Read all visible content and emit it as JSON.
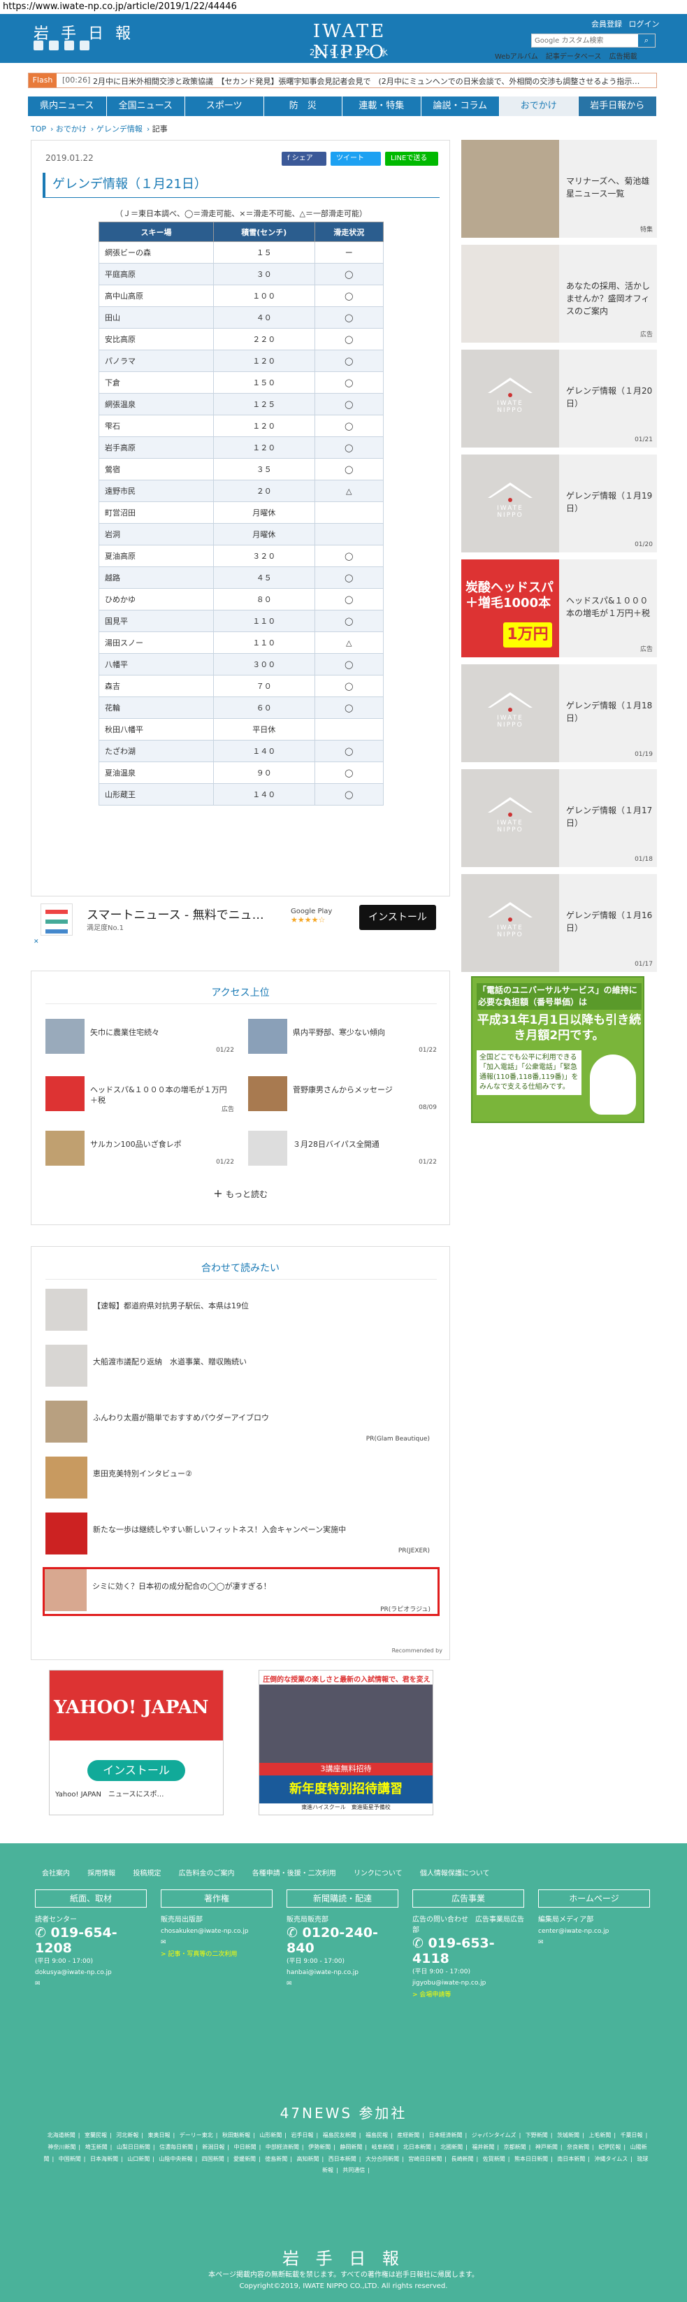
{
  "url": "https://www.iwate-np.co.jp/article/2019/1/22/44446",
  "header": {
    "logo": "岩 手 日 報",
    "brand": "IWATE NIPPO",
    "date": "2019.01.22. 水",
    "member_register": "会員登録",
    "login": "ログイン",
    "search_placeholder": "Google カスタム検索",
    "sublinks": [
      "Webアルバム",
      "記事データベース",
      "広告掲載"
    ]
  },
  "flash": {
    "tag": "Flash",
    "time": "[00:26]",
    "text": "2月中に日米外相間交渉と政策協議　【セカンド発見】張曙宇知事会見記者会見で　(2月中にミュンヘンでの日米会談で、外相間の交渉も調整させるよう指示…"
  },
  "nav": [
    "県内ニュース",
    "全国ニュース",
    "スポーツ",
    "防　災",
    "連載・特集",
    "論説・コラム",
    "おでかけ",
    "岩手日報から"
  ],
  "breadcrumb": [
    "TOP",
    "おでかけ",
    "ゲレンデ情報",
    "記事"
  ],
  "article": {
    "date": "2019.01.22",
    "share_fb": "f シェア",
    "share_tw": "ツイート",
    "share_line": "LINEで送る",
    "title": "ゲレンデ情報（１月21日）",
    "legend": "（Ｊ＝東日本調べ、◯＝滑走可能、×＝滑走不可能、△＝一部滑走可能）",
    "table_headers": [
      "スキー場",
      "積雪(センチ)",
      "滑走状況"
    ],
    "rows": [
      [
        "網張ビーの森",
        "１５",
        "ー"
      ],
      [
        "平庭高原",
        "３０",
        "◯"
      ],
      [
        "高中山高原",
        "１００",
        "◯"
      ],
      [
        "田山",
        "４０",
        "◯"
      ],
      [
        "安比高原",
        "２２０",
        "◯"
      ],
      [
        "パノラマ",
        "１２０",
        "◯"
      ],
      [
        "下倉",
        "１５０",
        "◯"
      ],
      [
        "網張温泉",
        "１２５",
        "◯"
      ],
      [
        "雫石",
        "１２０",
        "◯"
      ],
      [
        "岩手高原",
        "１２０",
        "◯"
      ],
      [
        "鶯宿",
        "３５",
        "◯"
      ],
      [
        "遠野市民",
        "２０",
        "△"
      ],
      [
        "町営沼田",
        "月曜休",
        ""
      ],
      [
        "岩洞",
        "月曜休",
        ""
      ],
      [
        "夏油高原",
        "３２０",
        "◯"
      ],
      [
        "越路",
        "４５",
        "◯"
      ],
      [
        "ひめかゆ",
        "８０",
        "◯"
      ],
      [
        "国見平",
        "１１０",
        "◯"
      ],
      [
        "湯田スノー",
        "１１０",
        "△"
      ],
      [
        "八幡平",
        "３００",
        "◯"
      ],
      [
        "森吉",
        "７０",
        "◯"
      ],
      [
        "花輪",
        "６０",
        "◯"
      ],
      [
        "秋田八幡平",
        "平日休",
        ""
      ],
      [
        "たざわ湖",
        "１４０",
        "◯"
      ],
      [
        "夏油温泉",
        "９０",
        "◯"
      ],
      [
        "山形蔵王",
        "１４０",
        "◯"
      ]
    ]
  },
  "app_ad": {
    "title": "スマートニュース - 無料でニュ…",
    "sub": "満足度No.1",
    "store": "Google Play",
    "stars": "★★★★☆",
    "install": "インストール"
  },
  "sidebar": [
    {
      "text": "マリナーズへ、菊池雄星ニュース一覧",
      "date": "特集"
    },
    {
      "text": "あなたの採用、活かしませんか？盛岡オフィスのご案内",
      "date": "広告"
    },
    {
      "text": "ゲレンデ情報（１月20日）",
      "date": "01/21"
    },
    {
      "text": "ゲレンデ情報（１月19日）",
      "date": "01/20"
    },
    {
      "text": "ヘッドスパ&１０００本の増毛が１万円＋税",
      "date": "広告",
      "ad_big": "炭酸ヘッドスパ＋増毛1000本",
      "ad_price": "1万円"
    },
    {
      "text": "ゲレンデ情報（１月18日）",
      "date": "01/19"
    },
    {
      "text": "ゲレンデ情報（１月17日）",
      "date": "01/18"
    },
    {
      "text": "ゲレンデ情報（１月16日）",
      "date": "01/17"
    }
  ],
  "access": {
    "title": "アクセス上位",
    "items": [
      {
        "text": "矢巾に農業住宅続々",
        "date": "01/22"
      },
      {
        "text": "県内平野部、寒少ない傾向",
        "date": "01/22"
      },
      {
        "text": "ヘッドスパ&１０００本の増毛が１万円＋税",
        "date": "広告"
      },
      {
        "text": "菅野康男さんからメッセージ",
        "date": "08/09"
      },
      {
        "text": "サルカン100品いざ食レポ",
        "date": "01/22"
      },
      {
        "text": "３月28日バイパス全開通",
        "date": "01/22"
      }
    ],
    "more": "もっと読む"
  },
  "denwa_ad": {
    "head": "「電話のユニバーサルサービス」の維持に必要な負担額（番号単価）は",
    "body": "平成31年1月1日以降も引き続き月額2円です。",
    "note": "全国どこでも公平に利用できる「加入電話」「公衆電話」「緊急通報(110番,118番,119番)」をみんなで支える仕組みです。"
  },
  "related": {
    "title": "合わせて読みたい",
    "items": [
      {
        "text": "【速報】都道府県対抗男子駅伝、本県は19位",
        "pr": ""
      },
      {
        "text": "大船渡市議配り返納　水道事業、贈収賄続い",
        "pr": ""
      },
      {
        "text": "ふんわり太眉が簡単でおすすめパウダーアイブロウ",
        "pr": "PR(Glam Beautique)"
      },
      {
        "text": "恵田克美特別インタビュー②",
        "pr": ""
      },
      {
        "text": "新たな一歩は継続しやすい新しいフィットネス！入会キャンペーン実施中",
        "pr": "PR(JEXER)"
      },
      {
        "text": "シミに効く？日本初の成分配合の◯◯が凄すぎる！",
        "pr": "PR(ラピオラジュ)"
      }
    ],
    "recommended": "Recommended by"
  },
  "yahoo_ad": {
    "logo": "YAHOO! JAPAN",
    "install": "インストール",
    "app": "Yahoo! JAPAN　ニュースにスポ…"
  },
  "juku_ad": {
    "top": "圧倒的な授業の楽しさと最新の入試情報で、君を変える",
    "band": "3講座無料招待",
    "main": "新年度特別招待講習",
    "foot": "東進ハイスクール　東進衛星予備校"
  },
  "footer": {
    "links": [
      "会社案内",
      "採用情報",
      "投稿規定",
      "広告料金のご案内",
      "各種申請・後援・二次利用",
      "リンクについて",
      "個人情報保護について"
    ],
    "cols": [
      {
        "head": "紙面、取材",
        "label": "読者センター",
        "tel": "019-654-1208",
        "time": "(平日 9:00 - 17:00)",
        "mail": "dokusya@iwate-np.co.jp",
        "note": ""
      },
      {
        "head": "著作権",
        "label": "販売局出版部",
        "tel": "",
        "time": "",
        "mail": "chosakuken@iwate-np.co.jp",
        "note": "> 記事・写真等の二次利用"
      },
      {
        "head": "新聞購読・配達",
        "label": "販売局販売部",
        "tel": "0120-240-840",
        "time": "(平日 9:00 - 17:00)",
        "mail": "hanbai@iwate-np.co.jp",
        "note": ""
      },
      {
        "head": "広告事業",
        "label": "広告の問い合わせ　広告事業局広告部",
        "tel": "019-653-4118",
        "time": "(平日 9:00 - 17:00)",
        "mail": "jigyobu@iwate-np.co.jp",
        "note": "> 会場申請等"
      },
      {
        "head": "ホームページ",
        "label": "編集局メディア部",
        "tel": "",
        "time": "",
        "mail": "center@iwate-np.co.jp",
        "note": ""
      }
    ],
    "n47_title": "47NEWS 参加社",
    "n47": [
      "北海道新聞",
      "室蘭民報",
      "河北新報",
      "東奥日報",
      "デーリー東北",
      "秋田魁新報",
      "山形新聞",
      "岩手日報",
      "福島民友新聞",
      "福島民報",
      "産経新聞",
      "日本経済新聞",
      "ジャパンタイムズ",
      "下野新聞",
      "茨城新聞",
      "上毛新聞",
      "千葉日報",
      "神奈川新聞",
      "埼玉新聞",
      "山梨日日新聞",
      "信濃毎日新聞",
      "新潟日報",
      "中日新聞",
      "中部経済新聞",
      "伊勢新聞",
      "静岡新聞",
      "岐阜新聞",
      "北日本新聞",
      "北國新聞",
      "福井新聞",
      "京都新聞",
      "神戸新聞",
      "奈良新聞",
      "紀伊民報",
      "山陽新聞",
      "中国新聞",
      "日本海新聞",
      "山口新聞",
      "山陰中央新報",
      "四国新聞",
      "愛媛新聞",
      "徳島新聞",
      "高知新聞",
      "西日本新聞",
      "大分合同新聞",
      "宮崎日日新聞",
      "長崎新聞",
      "佐賀新聞",
      "熊本日日新聞",
      "南日本新聞",
      "沖縄タイムス",
      "琉球新報",
      "共同通信"
    ],
    "logo": "岩 手 日 報",
    "copy1": "本ページ掲載内容の無断転載を禁じます。すべての著作権は岩手日報社に帰属します。",
    "copy2": "Copyright©2019, IWATE NIPPO CO.,LTD. All rights reserved."
  }
}
